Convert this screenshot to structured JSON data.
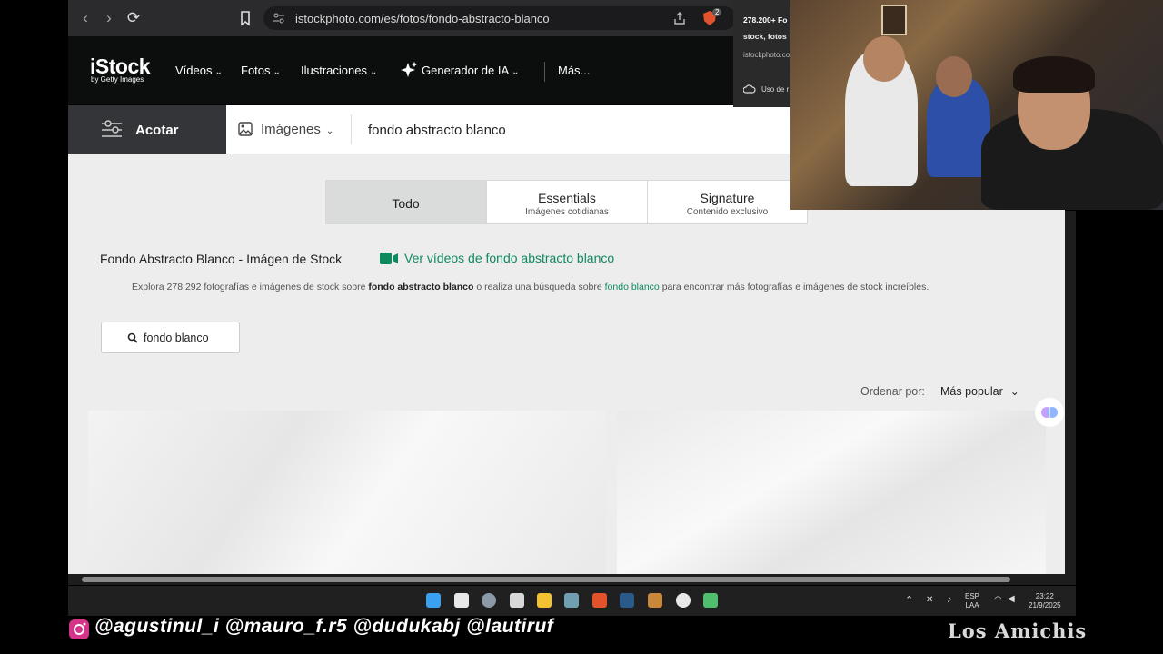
{
  "browser": {
    "url": "istockphoto.com/es/fotos/fondo-abstracto-blanco",
    "extension_badge": "2"
  },
  "header": {
    "logo": "iStock",
    "logo_sub": "by Getty Images",
    "nav": [
      {
        "label": "Vídeos"
      },
      {
        "label": "Fotos"
      },
      {
        "label": "Ilustraciones"
      },
      {
        "label": "Generador de IA"
      },
      {
        "label": "Más..."
      }
    ]
  },
  "search": {
    "filter_label": "Acotar",
    "type_label": "Imágenes",
    "query": "fondo abstracto blanco"
  },
  "tabs": [
    {
      "title": "Todo",
      "sub": ""
    },
    {
      "title": "Essentials",
      "sub": "Imágenes cotidianas"
    },
    {
      "title": "Signature",
      "sub": "Contenido exclusivo"
    }
  ],
  "content": {
    "heading": "Fondo Abstracto Blanco - Imágen de Stock",
    "video_link": "Ver vídeos de fondo abstracto blanco",
    "explore_prefix": "Explora 278.292 fotografías e imágenes de stock sobre",
    "explore_bold": "fondo abstracto blanco",
    "explore_middle": "o realiza una búsqueda sobre",
    "explore_link": "fondo blanco",
    "explore_suffix": "para encontrar más fotografías e imágenes de stock increíbles.",
    "related_chip": "fondo blanco",
    "sort_label": "Ordenar por:",
    "sort_value": "Más popular"
  },
  "notification": {
    "title": "278.200+ Fo",
    "subtitle": "stock, fotos",
    "domain": "istockphoto.co",
    "usage": "Uso de r"
  },
  "taskbar": {
    "lang_line1": "ESP",
    "lang_line2": "LAA",
    "time": "23:22",
    "date": "21/9/2025"
  },
  "overlay": {
    "socials": "@agustinul_i  @mauro_f.r5  @dudukabj @lautiruf",
    "brand": "Los Amichis"
  },
  "colors": {
    "accent_green": "#0f8a5f",
    "header_bg": "#0c0d0d",
    "content_bg": "#ecedec"
  }
}
